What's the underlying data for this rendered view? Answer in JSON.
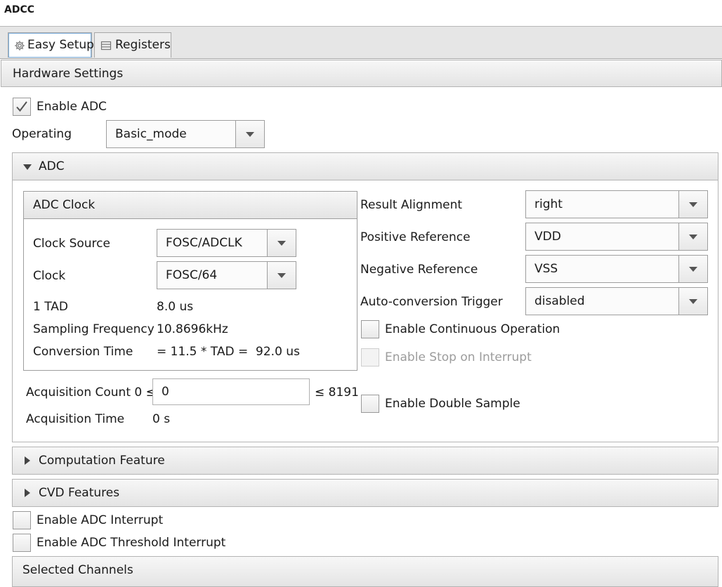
{
  "window": {
    "title": "ADCC"
  },
  "tabs": [
    {
      "label": "Easy Setup",
      "icon": "gear-icon",
      "active": true
    },
    {
      "label": "Registers",
      "icon": "list-icon",
      "active": false
    }
  ],
  "hardware_settings": {
    "title": "Hardware Settings",
    "enable_adc": {
      "label": "Enable ADC",
      "checked": true
    },
    "operating": {
      "label": "Operating",
      "value": "Basic_mode"
    }
  },
  "adc_section": {
    "title": "ADC",
    "expanded": true,
    "clock_panel": {
      "title": "ADC Clock",
      "clock_source": {
        "label": "Clock Source",
        "value": "FOSC/ADCLK"
      },
      "clock": {
        "label": "Clock",
        "value": "FOSC/64"
      },
      "tad": {
        "label": "1 TAD",
        "value": "8.0 us"
      },
      "sampling_frequency": {
        "label": "Sampling Frequency",
        "value": "10.8696kHz"
      },
      "conversion_time": {
        "label": "Conversion Time",
        "value": "= 11.5 * TAD =  92.0 us"
      }
    },
    "acquisition_count": {
      "label": "Acquisition Count 0 ≤",
      "value": "0",
      "max_label": "≤ 8191"
    },
    "acquisition_time": {
      "label": "Acquisition Time",
      "value": "0 s"
    },
    "result_alignment": {
      "label": "Result Alignment",
      "value": "right"
    },
    "positive_reference": {
      "label": "Positive Reference",
      "value": "VDD"
    },
    "negative_reference": {
      "label": "Negative Reference",
      "value": "VSS"
    },
    "auto_conversion_trigger": {
      "label": "Auto-conversion Trigger",
      "value": "disabled"
    },
    "enable_continuous_operation": {
      "label": "Enable Continuous Operation",
      "checked": false
    },
    "enable_stop_on_interrupt": {
      "label": "Enable Stop on Interrupt",
      "checked": false,
      "disabled": true
    },
    "enable_double_sample": {
      "label": "Enable Double Sample",
      "checked": false
    }
  },
  "computation_feature": {
    "title": "Computation Feature",
    "expanded": false
  },
  "cvd_features": {
    "title": "CVD Features",
    "expanded": false
  },
  "enable_adc_interrupt": {
    "label": "Enable ADC Interrupt",
    "checked": false
  },
  "enable_adc_threshold_interrupt": {
    "label": "Enable ADC Threshold Interrupt",
    "checked": false
  },
  "selected_channels": {
    "title": "Selected Channels"
  }
}
